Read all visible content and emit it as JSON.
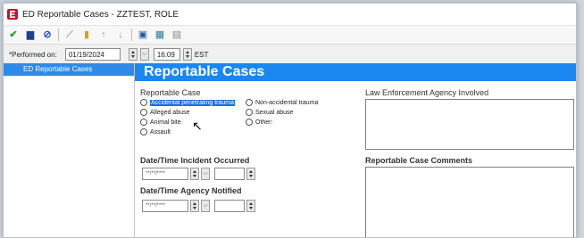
{
  "window": {
    "title": "ED Reportable Cases - ZZTEST, ROLE"
  },
  "toolbar": {
    "icons": [
      "checkmark-icon",
      "save-icon",
      "cancel-icon",
      "wand-icon",
      "lock-icon",
      "up-arrow-icon",
      "down-arrow-icon",
      "display-icon",
      "calendar-icon",
      "document-icon"
    ]
  },
  "performed": {
    "label": "*Performed on:",
    "date": "01/19/2024",
    "time": "16:09",
    "tz": "EST"
  },
  "nav": {
    "items": [
      {
        "label": "ED Reportable Cases"
      }
    ]
  },
  "main": {
    "title": "Reportable Cases",
    "case_label": "Reportable Case",
    "options": [
      {
        "label": "Accidental penetrating trauma",
        "selected_highlight": true
      },
      {
        "label": "Alleged abuse"
      },
      {
        "label": "Animal bite"
      },
      {
        "label": "Assault"
      },
      {
        "label": "Non-accidental trauma"
      },
      {
        "label": "Sexual abuse"
      },
      {
        "label": "Other:"
      }
    ],
    "law_label": "Law Enforcement Agency Involved",
    "incident_label": "Date/Time Incident Occurred",
    "notified_label": "Date/Time Agency Notified",
    "date_placeholder": "**/**/****",
    "comments_label": "Reportable Case Comments"
  },
  "colors": {
    "header_blue": "#1a86f0",
    "nav_selected": "#2e8ae6",
    "app_icon_red": "#c8102e"
  }
}
